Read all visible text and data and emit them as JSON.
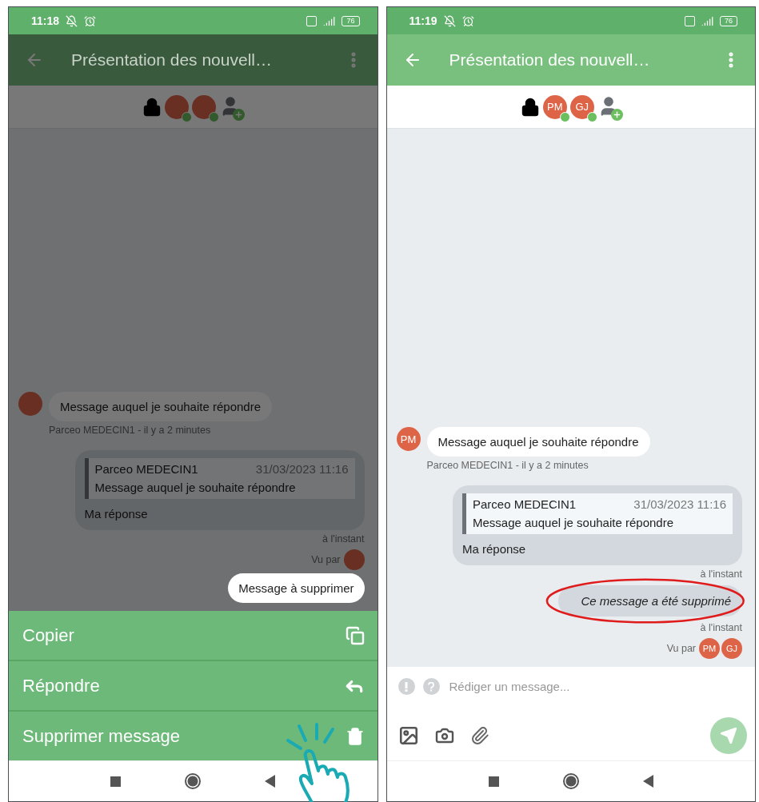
{
  "screens": [
    {
      "dimmed": true,
      "status_bar": {
        "time": "11:18",
        "battery": "76"
      },
      "header": {
        "title": "Présentation des nouvell…"
      },
      "participants": [
        {
          "kind": "lock"
        },
        {
          "kind": "avatar",
          "online": true
        },
        {
          "kind": "avatar",
          "online": true
        },
        {
          "kind": "add-user"
        }
      ],
      "messages": [
        {
          "kind": "incoming",
          "text": "Message auquel je souhaite répondre",
          "meta": "Parceo MEDECIN1 - il y a 2 minutes"
        },
        {
          "kind": "outgoing",
          "quote": {
            "author": "Parceo MEDECIN1",
            "date": "31/03/2023 11:16",
            "text": "Message auquel je souhaite répondre"
          },
          "text": "Ma réponse",
          "time": "à l'instant"
        },
        {
          "kind": "seen",
          "label": "Vu par",
          "avatars": [
            {
              "kind": "avatar"
            }
          ]
        },
        {
          "kind": "outgoing",
          "text": "Message à supprimer",
          "highlighted": true
        }
      ],
      "action_sheet": [
        {
          "label": "Copier",
          "kind": "copy"
        },
        {
          "label": "Répondre",
          "kind": "reply"
        },
        {
          "label": "Supprimer message",
          "kind": "delete"
        }
      ],
      "tap_hint": true
    },
    {
      "dimmed": false,
      "status_bar": {
        "time": "11:19",
        "battery": "76"
      },
      "header": {
        "title": "Présentation des nouvell…"
      },
      "participants": [
        {
          "kind": "lock"
        },
        {
          "kind": "avatar",
          "initials": "PM",
          "online": true
        },
        {
          "kind": "avatar",
          "initials": "GJ",
          "online": true
        },
        {
          "kind": "add-user"
        }
      ],
      "messages": [
        {
          "kind": "incoming",
          "avatar": "PM",
          "text": "Message auquel je souhaite répondre",
          "meta": "Parceo MEDECIN1 - il y a 2 minutes"
        },
        {
          "kind": "outgoing",
          "quote": {
            "author": "Parceo MEDECIN1",
            "date": "31/03/2023 11:16",
            "text": "Message auquel je souhaite répondre"
          },
          "text": "Ma réponse",
          "time": "à l'instant"
        },
        {
          "kind": "outgoing",
          "text": "Ce message a été supprimé",
          "deleted": true,
          "circled": true,
          "time": "à l'instant"
        },
        {
          "kind": "seen",
          "label": "Vu par",
          "avatars": [
            {
              "kind": "avatar",
              "initials": "PM"
            },
            {
              "kind": "avatar",
              "initials": "GJ"
            }
          ]
        }
      ],
      "composer": {
        "placeholder": "Rédiger un message..."
      }
    }
  ]
}
